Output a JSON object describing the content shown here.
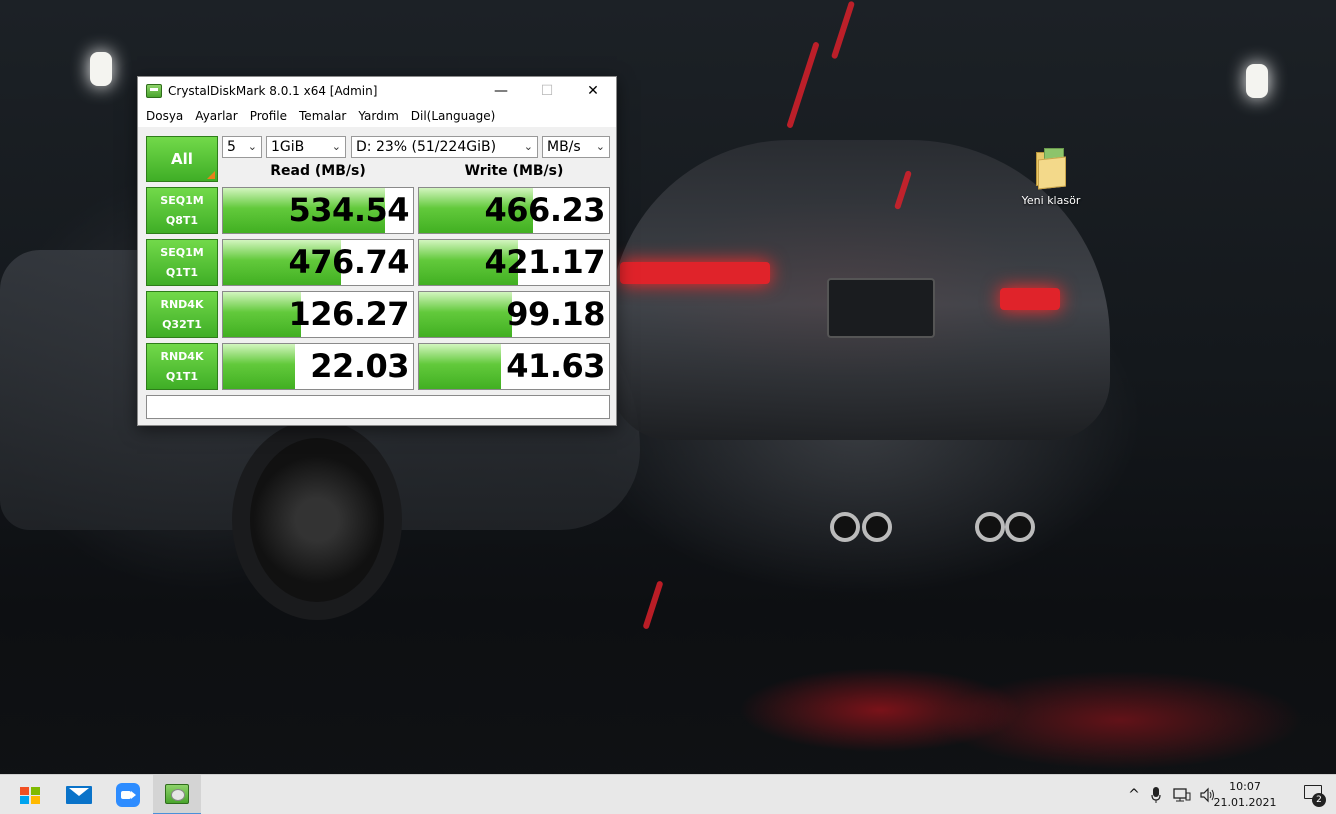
{
  "desktop": {
    "icon_label": "Yeni klasör"
  },
  "window": {
    "title": "CrystalDiskMark 8.0.1 x64 [Admin]",
    "controls": {
      "minimize": "—",
      "maximize": "☐",
      "close": "✕"
    },
    "menu": [
      "Dosya",
      "Ayarlar",
      "Profile",
      "Temalar",
      "Yardım",
      "Dil(Language)"
    ],
    "all_button": "All",
    "count_select": "5",
    "size_select": "1GiB",
    "drive_select": "D: 23% (51/224GiB)",
    "unit_select": "MB/s",
    "read_header": "Read (MB/s)",
    "write_header": "Write (MB/s)",
    "tests": [
      {
        "line1": "SEQ1M",
        "line2": "Q8T1",
        "read": "534.54",
        "write": "466.23",
        "read_fill": 0.85,
        "write_fill": 0.6
      },
      {
        "line1": "SEQ1M",
        "line2": "Q1T1",
        "read": "476.74",
        "write": "421.17",
        "read_fill": 0.62,
        "write_fill": 0.52
      },
      {
        "line1": "RND4K",
        "line2": "Q32T1",
        "read": "126.27",
        "write": "99.18",
        "read_fill": 0.41,
        "write_fill": 0.49
      },
      {
        "line1": "RND4K",
        "line2": "Q1T1",
        "read": "22.03",
        "write": "41.63",
        "read_fill": 0.38,
        "write_fill": 0.43
      }
    ],
    "status_text": ""
  },
  "taskbar": {
    "time": "10:07",
    "date": "21.01.2021",
    "notification_count": "2",
    "tray_chevron": "^"
  }
}
